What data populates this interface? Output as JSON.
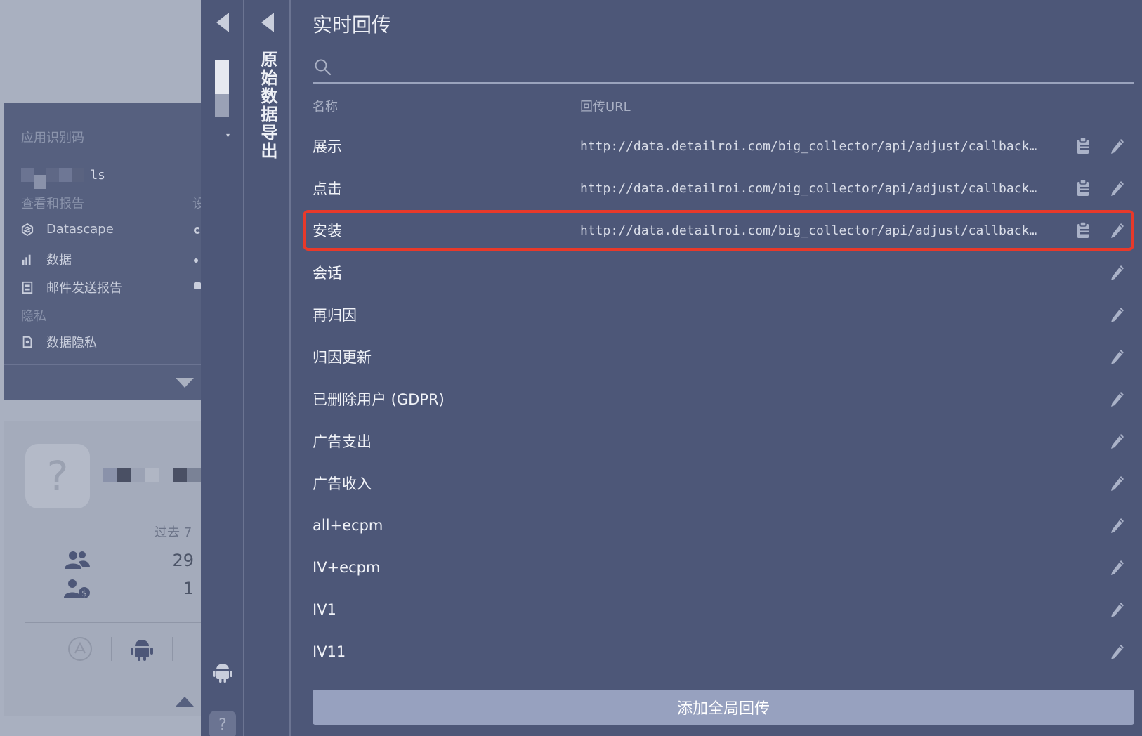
{
  "left_panel": {
    "app_id_label": "应用识别码",
    "app_name_suffix": "ls",
    "section_reports": "查看和报告",
    "section_reports_trailing": "设",
    "menu_items": [
      {
        "label": "Datascape",
        "icon": "datascape-icon"
      },
      {
        "label": "数据",
        "icon": "bar-chart-icon"
      },
      {
        "label": "邮件发送报告",
        "icon": "report-icon"
      }
    ],
    "section_privacy": "隐私",
    "privacy_item": {
      "label": "数据隐私",
      "icon": "privacy-doc-icon"
    },
    "card": {
      "avatar_placeholder": "?",
      "period_label": "过去 7",
      "stats": [
        {
          "icon": "users-icon",
          "value": "29"
        },
        {
          "icon": "paying-users-icon",
          "value": "1"
        }
      ],
      "platforms": [
        "app-store-icon",
        "android-icon"
      ]
    }
  },
  "slim_sidebar": {
    "vertical_title": "原始数据导出"
  },
  "main": {
    "title": "实时回传",
    "search_placeholder": "",
    "columns": {
      "name": "名称",
      "url": "回传URL"
    },
    "rows": [
      {
        "name": "展示",
        "url": "http://data.detailroi.com/big_collector/api/adjust/callback?app_token=...",
        "has_url": true
      },
      {
        "name": "点击",
        "url": "http://data.detailroi.com/big_collector/api/adjust/callback?app_token=...",
        "has_url": true
      },
      {
        "name": "安装",
        "url": "http://data.detailroi.com/big_collector/api/adjust/callback?app_token=...",
        "has_url": true,
        "highlighted": true
      },
      {
        "name": "会话",
        "url": "",
        "has_url": false
      },
      {
        "name": "再归因",
        "url": "",
        "has_url": false
      },
      {
        "name": "归因更新",
        "url": "",
        "has_url": false
      },
      {
        "name": "已删除用户 (GDPR)",
        "url": "",
        "has_url": false
      },
      {
        "name": "广告支出",
        "url": "",
        "has_url": false
      },
      {
        "name": "广告收入",
        "url": "",
        "has_url": false
      },
      {
        "name": "all+ecpm",
        "url": "",
        "has_url": false
      },
      {
        "name": "IV+ecpm",
        "url": "",
        "has_url": false
      },
      {
        "name": "IV1",
        "url": "",
        "has_url": false
      },
      {
        "name": "IV11",
        "url": "",
        "has_url": false
      }
    ],
    "add_button": "添加全局回传"
  },
  "colors": {
    "panel_bg": "#4d5778",
    "highlight_border": "#e8392a",
    "add_button_bg": "#97a1bf"
  }
}
